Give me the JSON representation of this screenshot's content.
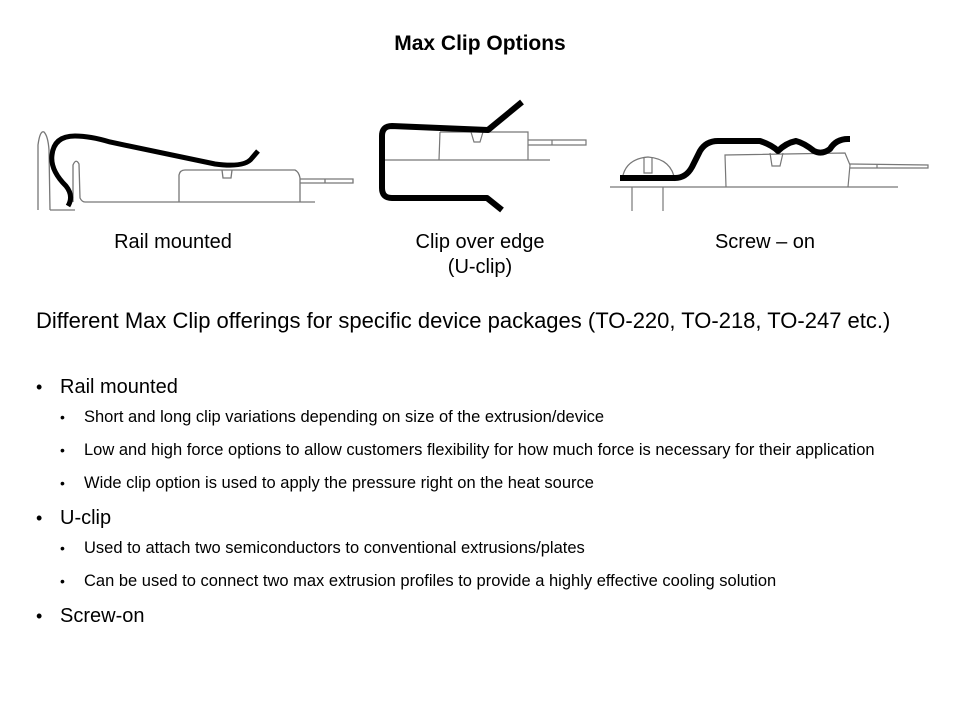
{
  "title": "Max Clip Options",
  "figures": [
    {
      "icon": "rail-mounted-clip-diagram",
      "label_line1": "Rail mounted",
      "label_line2": ""
    },
    {
      "icon": "u-clip-diagram",
      "label_line1": "Clip over edge",
      "label_line2": "(U-clip)"
    },
    {
      "icon": "screw-on-clip-diagram",
      "label_line1": "Screw – on",
      "label_line2": ""
    }
  ],
  "intro": "Different Max Clip offerings for specific device packages (TO-220, TO-218, TO-247 etc.)",
  "bullets": [
    {
      "label": "Rail mounted",
      "sub": [
        "Short and long clip variations depending  on size of the extrusion/device",
        "Low and high  force options to allow customers flexibility for how much  force is necessary for their application",
        "Wide clip option is used to apply the pressure right on the heat source"
      ]
    },
    {
      "label": "U-clip",
      "sub": [
        "Used to attach two semiconductors to conventional extrusions/plates",
        "Can be used to connect two max  extrusion profiles to provide a highly  effective cooling solution"
      ]
    },
    {
      "label": "Screw-on",
      "sub": []
    }
  ]
}
